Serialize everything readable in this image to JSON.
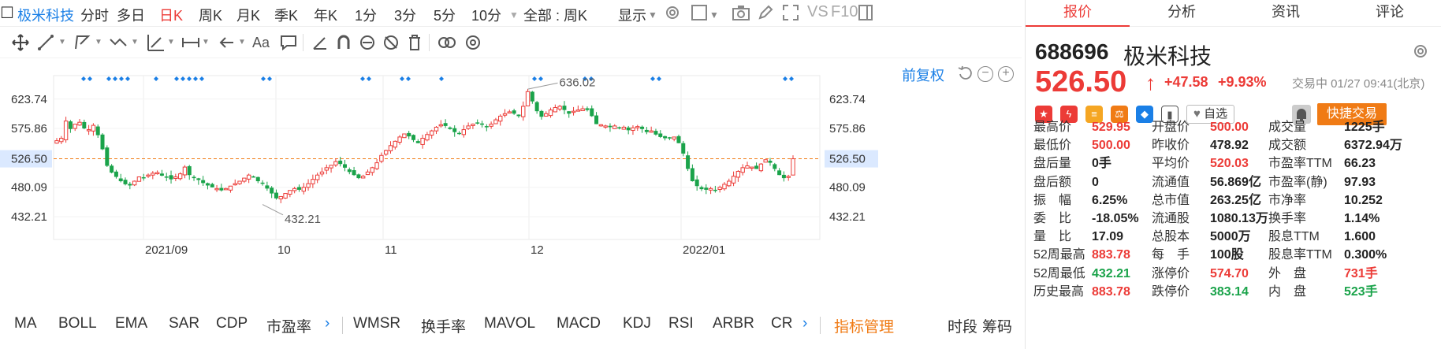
{
  "period_bar": {
    "stock_name": "极米科技",
    "items": [
      "分时",
      "多日",
      "日K",
      "周K",
      "月K",
      "季K",
      "年K",
      "1分",
      "3分",
      "5分",
      "10分"
    ],
    "active": "日K",
    "all_weekly": "全部 : 周K",
    "display": "显示",
    "vs_label": "VS",
    "f10_label": "F10"
  },
  "toolbar": {
    "font_label": "Aa"
  },
  "chart": {
    "adjust_label": "前复权",
    "current_price_label": "526.50",
    "high_annotation": "636.02",
    "low_annotation": "432.21",
    "y_ticks_left": [
      "623.74",
      "575.86",
      "526.50",
      "480.09",
      "432.21"
    ],
    "y_ticks_right": [
      "623.74",
      "575.86",
      "526.50",
      "480.09",
      "432.21"
    ],
    "x_ticks": [
      "2021/09",
      "10",
      "11",
      "12",
      "2022/01"
    ]
  },
  "chart_data": {
    "type": "candlestick",
    "current_price": 526.5,
    "y_ticks": [
      623.74,
      575.86,
      526.5,
      480.09,
      432.21
    ],
    "high_point": 636.02,
    "low_point": 432.21,
    "x_ticks": [
      "2021/09",
      "10",
      "11",
      "12",
      "2022/01"
    ],
    "colors": {
      "up": "#ec3b37",
      "down": "#1aa34a",
      "marker": "#1a7fe6",
      "price_line": "#f07b15"
    },
    "closes_approx": [
      556,
      560,
      588,
      575,
      583,
      586,
      576,
      574,
      581,
      565,
      542,
      515,
      504,
      497,
      490,
      485,
      483,
      490,
      497,
      496,
      500,
      503,
      504,
      499,
      497,
      493,
      497,
      502,
      513,
      500,
      495,
      492,
      487,
      483,
      480,
      478,
      475,
      478,
      482,
      486,
      490,
      495,
      500,
      496,
      490,
      486,
      478,
      470,
      462,
      465,
      470,
      475,
      478,
      476,
      480,
      486,
      493,
      500,
      505,
      512,
      516,
      522,
      518,
      512,
      505,
      500,
      495,
      498,
      505,
      512,
      520,
      532,
      540,
      548,
      555,
      562,
      567,
      563,
      557,
      552,
      560,
      566,
      572,
      578,
      582,
      580,
      575,
      570,
      568,
      574,
      580,
      583,
      585,
      582,
      578,
      583,
      590,
      596,
      600,
      603,
      600,
      596,
      612,
      636,
      620,
      604,
      595,
      600,
      606,
      610,
      612,
      606,
      600,
      604,
      606,
      608,
      606,
      596,
      583,
      582,
      580,
      578,
      580,
      577,
      578,
      573,
      577,
      579,
      575,
      570,
      572,
      566,
      562,
      560,
      560,
      562,
      552,
      535,
      510,
      490,
      482,
      477,
      476,
      478,
      476,
      480,
      485,
      490,
      498,
      506,
      512,
      515,
      513,
      510,
      518,
      525,
      520,
      510,
      500,
      495,
      498,
      526.5
    ]
  },
  "indicators": {
    "tabs": [
      "MA",
      "BOLL",
      "EMA",
      "SAR",
      "CDP",
      "市盈率",
      "WMSR",
      "换手率",
      "MAVOL",
      "MACD",
      "KDJ",
      "RSI",
      "ARBR",
      "CR"
    ],
    "manage": "指标管理",
    "timeshare": "时段",
    "chips": "筹码"
  },
  "quote": {
    "tabs": [
      "报价",
      "分析",
      "资讯",
      "评论"
    ],
    "active_tab": "报价",
    "code": "688696",
    "name": "极米科技",
    "price": "526.50",
    "change": "+47.58",
    "change_pct": "+9.93%",
    "status": "交易中 01/27 09:41(北京)",
    "watch_label": "自选",
    "quick_trade": "快捷交易",
    "fields": [
      [
        {
          "label": "最高价",
          "value": "529.95",
          "color": "red"
        },
        {
          "label": "开盘价",
          "value": "500.00",
          "color": "red"
        },
        {
          "label": "成交量",
          "value": "1225手",
          "color": "dark"
        }
      ],
      [
        {
          "label": "最低价",
          "value": "500.00",
          "color": "red"
        },
        {
          "label": "昨收价",
          "value": "478.92",
          "color": "dark"
        },
        {
          "label": "成交额",
          "value": "6372.94万",
          "color": "dark"
        }
      ],
      [
        {
          "label": "盘后量",
          "value": "0手",
          "color": "dark"
        },
        {
          "label": "平均价",
          "value": "520.03",
          "color": "red"
        },
        {
          "label": "市盈率TTM",
          "value": "66.23",
          "color": "dark"
        }
      ],
      [
        {
          "label": "盘后额",
          "value": "0",
          "color": "dark"
        },
        {
          "label": "流通值",
          "value": "56.869亿",
          "color": "dark"
        },
        {
          "label": "市盈率(静)",
          "value": "97.93",
          "color": "dark"
        }
      ],
      [
        {
          "label": "振　幅",
          "value": "6.25%",
          "color": "dark"
        },
        {
          "label": "总市值",
          "value": "263.25亿",
          "color": "dark"
        },
        {
          "label": "市净率",
          "value": "10.252",
          "color": "dark"
        }
      ],
      [
        {
          "label": "委　比",
          "value": "-18.05%",
          "color": "dark"
        },
        {
          "label": "流通股",
          "value": "1080.13万",
          "color": "dark"
        },
        {
          "label": "换手率",
          "value": "1.14%",
          "color": "dark"
        }
      ],
      [
        {
          "label": "量　比",
          "value": "17.09",
          "color": "dark"
        },
        {
          "label": "总股本",
          "value": "5000万",
          "color": "dark"
        },
        {
          "label": "股息TTM",
          "value": "1.600",
          "color": "dark"
        }
      ],
      [
        {
          "label": "52周最高",
          "value": "883.78",
          "color": "red"
        },
        {
          "label": "每　手",
          "value": "100股",
          "color": "dark"
        },
        {
          "label": "股息率TTM",
          "value": "0.300%",
          "color": "dark"
        }
      ],
      [
        {
          "label": "52周最低",
          "value": "432.21",
          "color": "green"
        },
        {
          "label": "涨停价",
          "value": "574.70",
          "color": "red"
        },
        {
          "label": "外　盘",
          "value": "731手",
          "color": "red"
        }
      ],
      [
        {
          "label": "历史最高",
          "value": "883.78",
          "color": "red"
        },
        {
          "label": "跌停价",
          "value": "383.14",
          "color": "green"
        },
        {
          "label": "内　盘",
          "value": "523手",
          "color": "green"
        }
      ]
    ]
  }
}
